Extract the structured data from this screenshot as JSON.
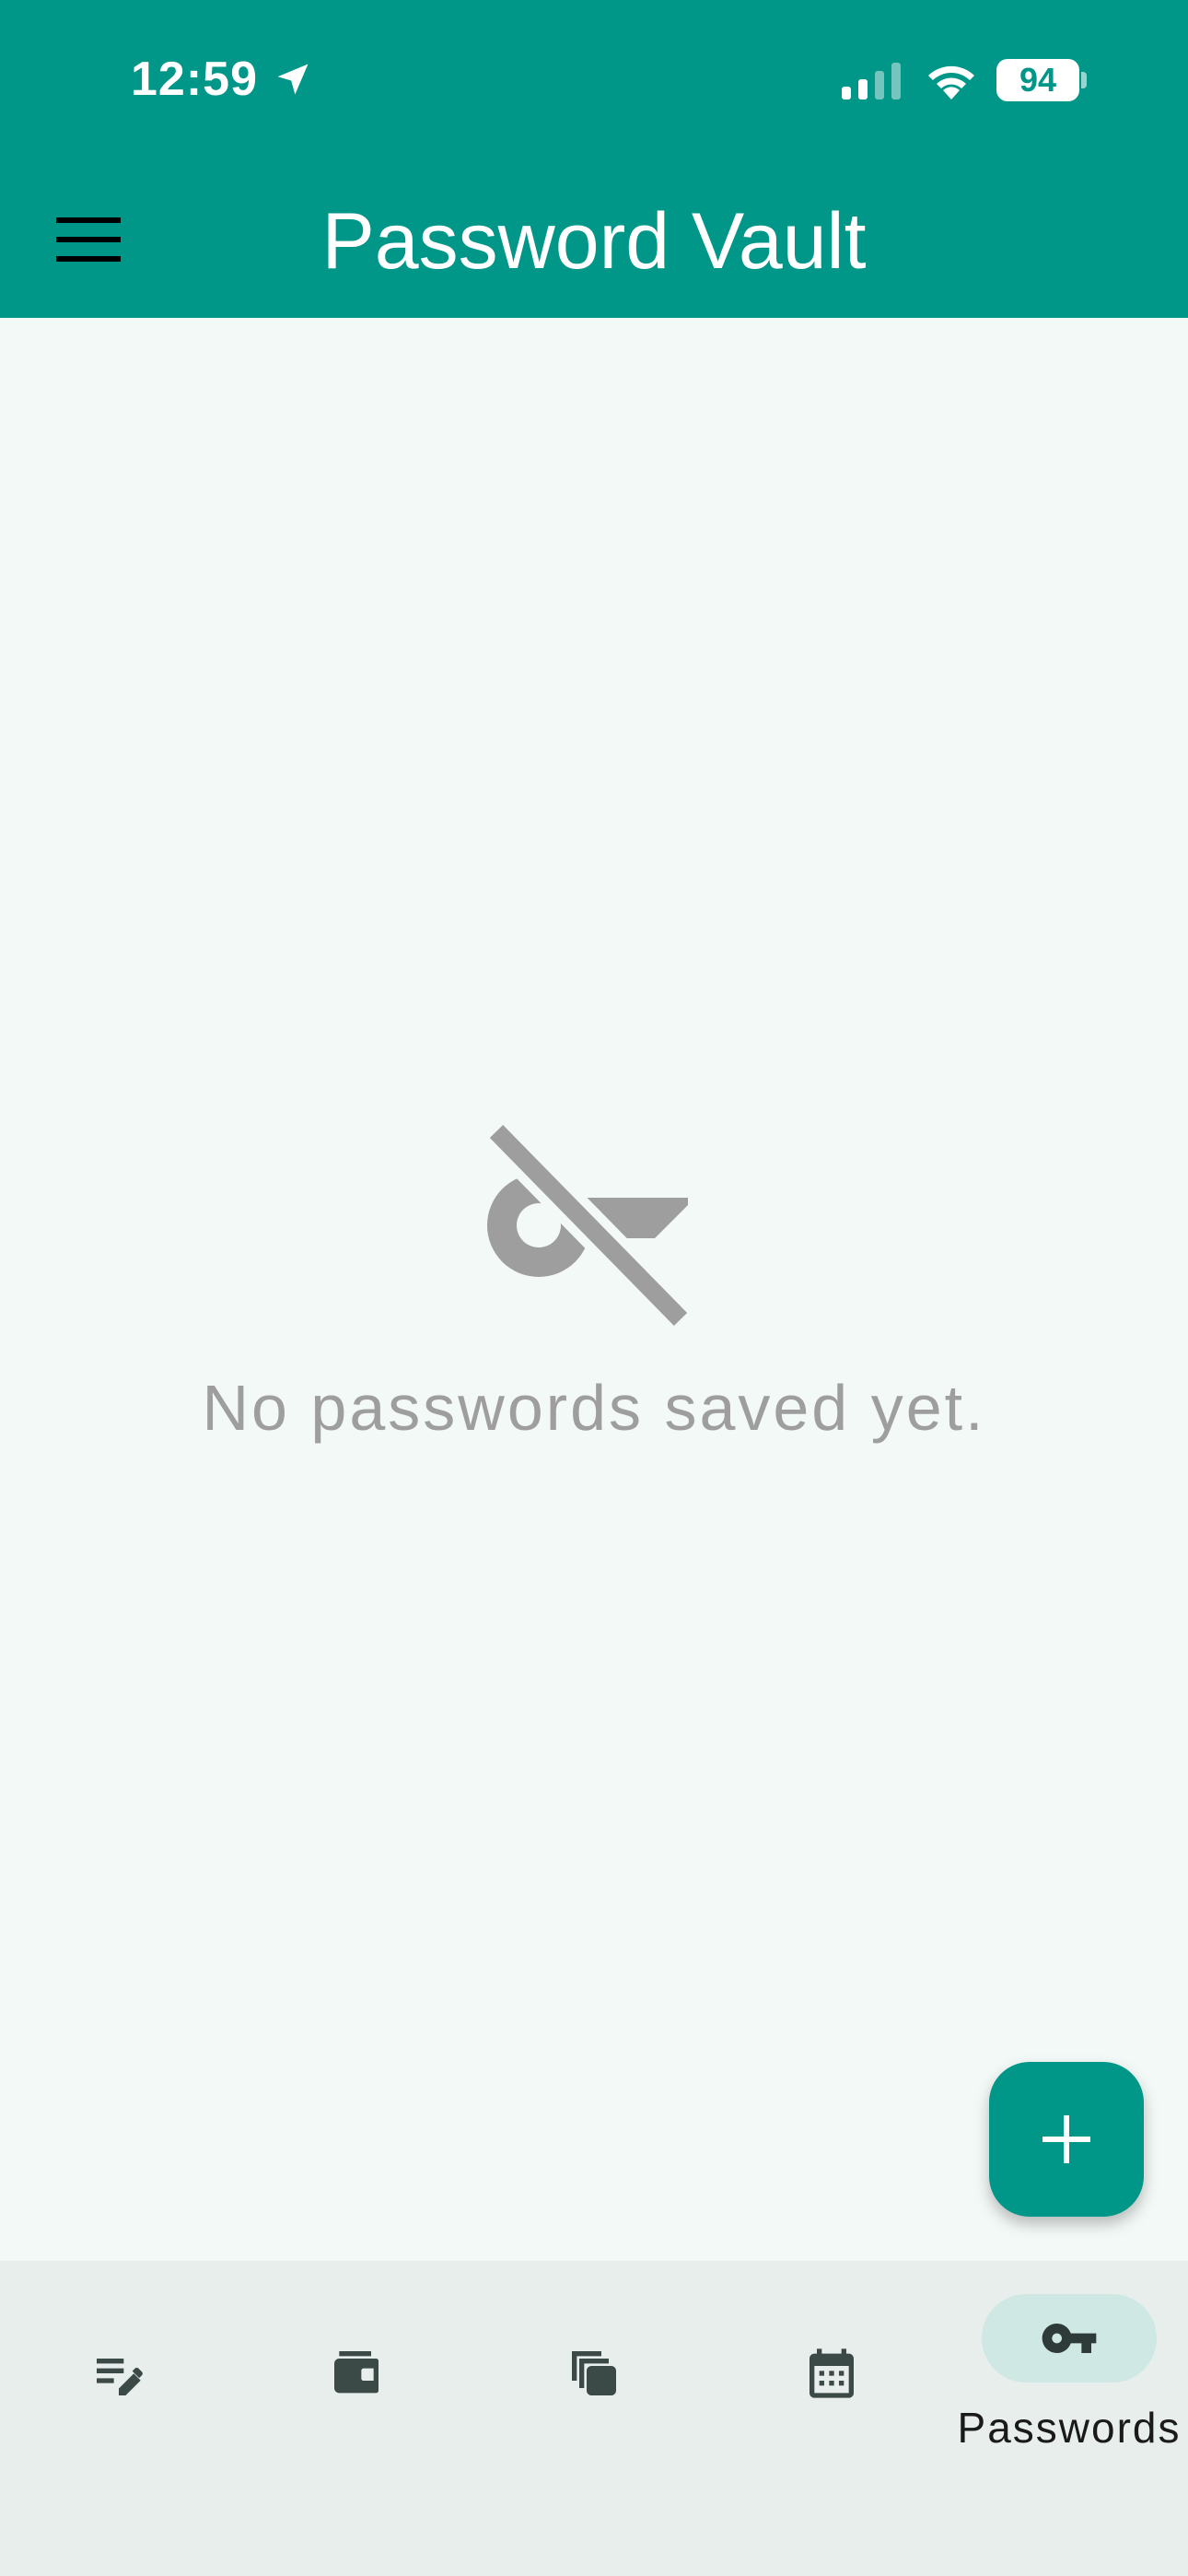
{
  "status_bar": {
    "time": "12:59",
    "battery": "94",
    "icons": [
      "location-arrow-icon",
      "cellular-signal-icon",
      "wifi-icon",
      "battery-icon"
    ]
  },
  "app_bar": {
    "title": "Password Vault",
    "menu_icon": "hamburger-menu-icon"
  },
  "empty_state": {
    "icon": "key-off-icon",
    "message": "No passwords saved yet."
  },
  "fab": {
    "icon": "plus-icon"
  },
  "bottom_nav": {
    "items": [
      {
        "icon": "notes-edit-icon",
        "label": ""
      },
      {
        "icon": "wallet-icon",
        "label": ""
      },
      {
        "icon": "stacked-cards-icon",
        "label": ""
      },
      {
        "icon": "calendar-icon",
        "label": ""
      },
      {
        "icon": "key-icon",
        "label": "Passwords",
        "active": true
      }
    ]
  },
  "colors": {
    "primary": "#009688",
    "background": "#f3f9f7",
    "nav_background": "#e8eeec",
    "active_pill": "#cfe8e3",
    "empty_text": "#9e9e9e"
  }
}
